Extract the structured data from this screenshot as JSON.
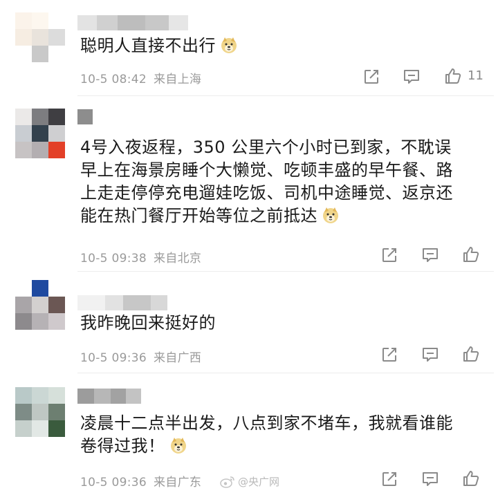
{
  "comments": [
    {
      "username": "",
      "text_lines": [
        "聪明人直接不出行"
      ],
      "time": "10-5 08:42",
      "location": "来自上海",
      "like_count": "11",
      "emoji": "doge-emoji"
    },
    {
      "username": "",
      "text_lines": [
        "4号入夜返程，350 公里六个小时已到家，不耽误",
        "早上在海景房睡个大懒觉、吃顿丰盛的早午餐、路",
        "上走走停停充电遛娃吃饭、司机中途睡觉、返京还",
        "能在热门餐厅开始等位之前抵达"
      ],
      "time": "10-5 09:38",
      "location": "来自北京",
      "like_count": "",
      "emoji": "doge-emoji"
    },
    {
      "username": "",
      "text_lines": [
        "我昨晚回来挺好的"
      ],
      "time": "10-5 09:36",
      "location": "来自广西",
      "like_count": "",
      "emoji": ""
    },
    {
      "username": "",
      "text_lines": [
        "凌晨十二点半出发，八点到家不堵车，我就看谁能",
        "卷得过我！"
      ],
      "time": "10-5 09:36",
      "location": "来自广东",
      "like_count": "",
      "emoji": "doge-emoji"
    }
  ],
  "actions": {
    "share_icon": "share-icon",
    "comment_icon": "comment-icon",
    "like_icon": "thumbs-up-icon"
  },
  "watermark": {
    "text": "@央广网",
    "icon": "weibo-logo"
  },
  "colors": {
    "text": "#1a1a1a",
    "meta": "#9a9a9a",
    "icon": "#8a8a8a",
    "divider": "#ececec"
  }
}
